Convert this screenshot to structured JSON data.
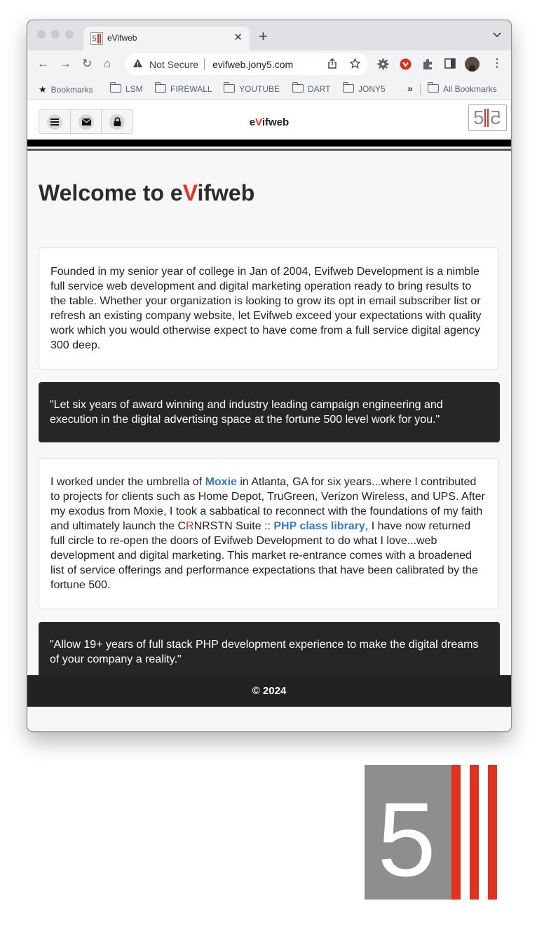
{
  "browser": {
    "tab": {
      "title": "eVifweb",
      "close_glyph": "✕"
    },
    "new_tab_glyph": "+",
    "tab_menu_glyph": "⌄",
    "nav": {
      "back": "←",
      "forward": "→",
      "reload": "↻",
      "home": "⌂"
    },
    "omnibox": {
      "security_label": "Not Secure",
      "url": "evifweb.jony5.com"
    },
    "bookmarks": {
      "items": [
        "Bookmarks",
        "LSM",
        "FIREWALL",
        "YOUTUBE",
        "DART",
        "JONY5"
      ],
      "overflow": "»",
      "all_bookmarks": "All Bookmarks"
    }
  },
  "site": {
    "name_prefix": "e",
    "name_accent": "V",
    "name_suffix": "ifweb",
    "logo_text": "5",
    "heading": {
      "prefix": "Welcome to e",
      "accent": "V",
      "suffix": "ifweb"
    },
    "intro": "Founded in my senior year of college in Jan of 2004, Evifweb Development is a nimble full service web development and digital marketing operation ready to bring results to the table. Whether your organization is looking to grow its opt in email subscriber list or refresh an existing company website, let Evifweb exceed your expectations with quality work which you would otherwise expect to have come from a full service digital agency 300 deep.",
    "quote1": "\"Let six years of award winning and industry leading campaign engineering and execution in the digital advertising space at the fortune 500 level work for you.\"",
    "story": {
      "p1": "I worked under the umbrella of ",
      "link1": "Moxie",
      "p2": " in Atlanta, GA for six years...where I contributed to projects for clients such as Home Depot, TruGreen, Verizon Wireless, and UPS. After my exodus from Moxie, I took a sabbatical to reconnect with the foundations of my faith and ultimately launch the C",
      "accent": "R",
      "p3": "NRSTN Suite :: ",
      "link2": "PHP class library",
      "p4": ", I have now returned full circle to re-open the doors of Evifweb Development to do what I love...web development and digital marketing. This market re-entrance comes with a broadened list of service offerings and performance expectations that have been calibrated by the fortune 500."
    },
    "quote2": "\"Allow 19+ years of full stack PHP development experience to make the digital dreams of your company a reality.\"",
    "footer": "© 2024"
  },
  "colors": {
    "accent": "#e2321f",
    "link": "#3c78c8",
    "dark": "#262626",
    "logo_gray": "#8e8e8e"
  },
  "icons": [
    "menu-icon",
    "mail-icon",
    "lock-icon",
    "warning-icon",
    "share-icon",
    "star-icon",
    "settings-extension-icon",
    "adblock-extension-icon",
    "puzzle-icon",
    "sidebar-icon",
    "avatar",
    "folder-icon"
  ]
}
